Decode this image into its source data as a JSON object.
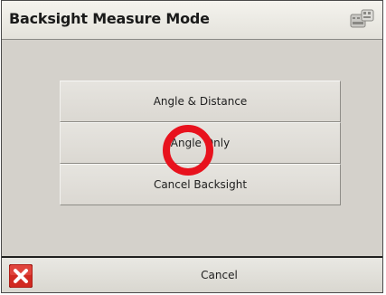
{
  "window": {
    "title": "Backsight Measure Mode",
    "title_icon": "keyboard-icon"
  },
  "menu": {
    "buttons": [
      {
        "label": "Angle & Distance"
      },
      {
        "label": "Angle Only"
      },
      {
        "label": "Cancel Backsight"
      }
    ],
    "highlighted_button": "Angle Only"
  },
  "footer": {
    "cancel_icon": "close-x-icon",
    "cancel_label": "Cancel"
  },
  "colors": {
    "highlight_ring": "#e8121d",
    "cancel_icon_bg": "#d12a22"
  }
}
